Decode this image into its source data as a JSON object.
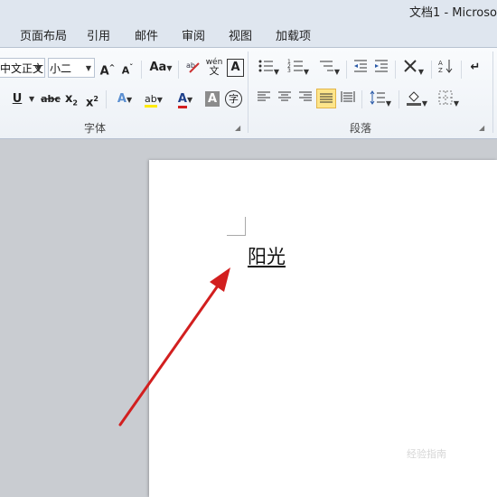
{
  "window": {
    "title": "文档1 - Microso"
  },
  "tabs": [
    "页面布局",
    "引用",
    "邮件",
    "审阅",
    "视图",
    "加载项"
  ],
  "font_group": {
    "label": "字体",
    "font_name": "中文正文",
    "font_size": "小二",
    "grow_font": "A",
    "shrink_font": "A",
    "change_case": "Aa",
    "phonetic": "wén",
    "char_border": "A",
    "underline": "U",
    "strikethrough": "abc",
    "subscript": "x",
    "superscript": "x",
    "text_effect": "A",
    "highlight": "ab",
    "font_color": "A",
    "char_shading": "A",
    "enclose_char": "字"
  },
  "paragraph_group": {
    "label": "段落"
  },
  "document": {
    "text": "阳光"
  },
  "watermark": {
    "text": "经验指南"
  },
  "colors": {
    "accent_red": "#d21f1f",
    "highlight_yellow": "#ffea00",
    "selected_bg": "#fde58a"
  }
}
